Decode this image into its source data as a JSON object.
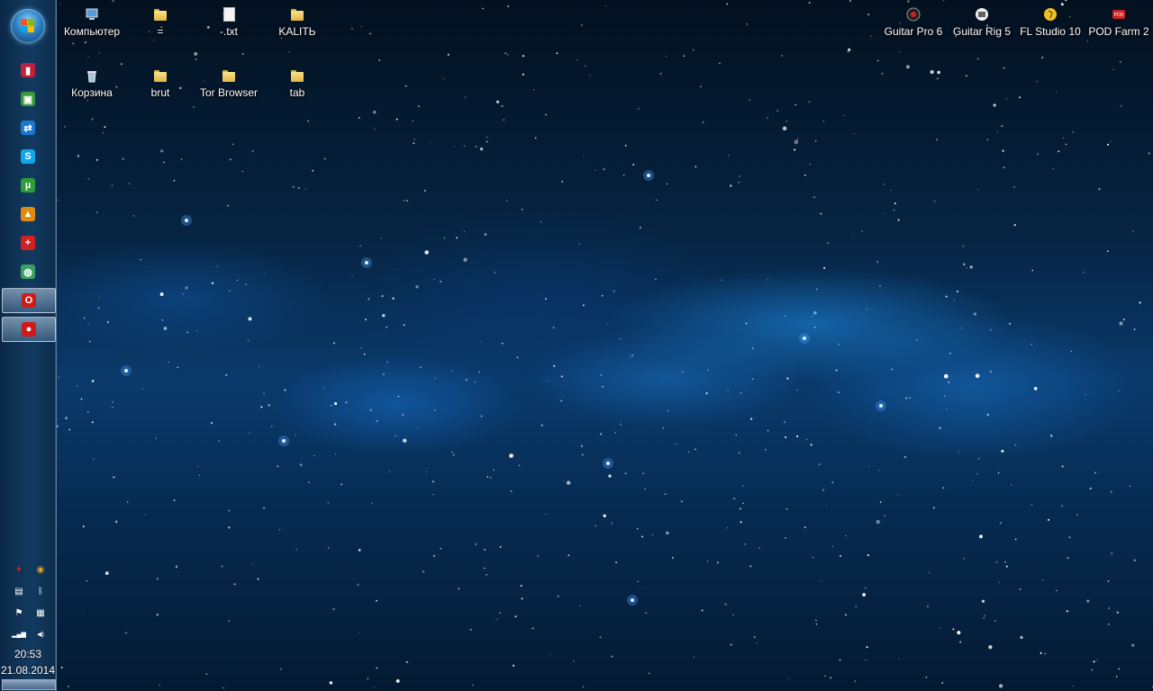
{
  "desktop": {
    "left_icons": [
      {
        "label": "Компьютер",
        "icon": "computer-icon"
      },
      {
        "label": "=",
        "icon": "folder-icon"
      },
      {
        "label": "-.txt",
        "icon": "text-file-icon"
      },
      {
        "label": "KALITЬ",
        "icon": "folder-icon"
      },
      {
        "label": "Корзина",
        "icon": "recycle-bin-icon"
      },
      {
        "label": "brut",
        "icon": "folder-icon"
      },
      {
        "label": "Tor Browser",
        "icon": "folder-icon"
      },
      {
        "label": "tab",
        "icon": "folder-icon"
      }
    ],
    "right_icons": [
      {
        "label": "Guitar Pro 6",
        "icon": "guitar-pro-icon"
      },
      {
        "label": "Guitar Rig 5",
        "icon": "guitar-rig-icon"
      },
      {
        "label": "FL Studio 10",
        "icon": "fl-studio-icon"
      },
      {
        "label": "POD Farm 2",
        "icon": "pod-farm-icon"
      }
    ]
  },
  "taskbar": {
    "pinned": [
      {
        "icon": "usb-drive-icon",
        "color": "#c0203a"
      },
      {
        "icon": "remote-desktop-icon",
        "color": "#3a9a3a"
      },
      {
        "icon": "teamviewer-icon",
        "color": "#1a78d0"
      },
      {
        "icon": "skype-icon",
        "color": "#12a5e8"
      },
      {
        "icon": "utorrent-icon",
        "color": "#2e9e3a"
      },
      {
        "icon": "aimp-icon",
        "color": "#e08a10"
      },
      {
        "icon": "medic-cross-icon",
        "color": "#d02020"
      },
      {
        "icon": "globe-icon",
        "color": "#3aa060"
      },
      {
        "icon": "opera-icon",
        "color": "#d01a1a",
        "active": true
      },
      {
        "icon": "bullet-red-icon",
        "color": "#d01a1a",
        "active": true
      }
    ],
    "tray": [
      {
        "icon": "antivirus-tray-icon"
      },
      {
        "icon": "chrome-tray-icon"
      },
      {
        "icon": "app-window-tray-icon"
      },
      {
        "icon": "bluetooth-tray-icon"
      },
      {
        "icon": "flag-tray-icon"
      },
      {
        "icon": "device-tray-icon"
      },
      {
        "icon": "network-signal-tray-icon"
      },
      {
        "icon": "volume-tray-icon"
      }
    ],
    "time": "20:53",
    "date": "21.08.2014"
  }
}
